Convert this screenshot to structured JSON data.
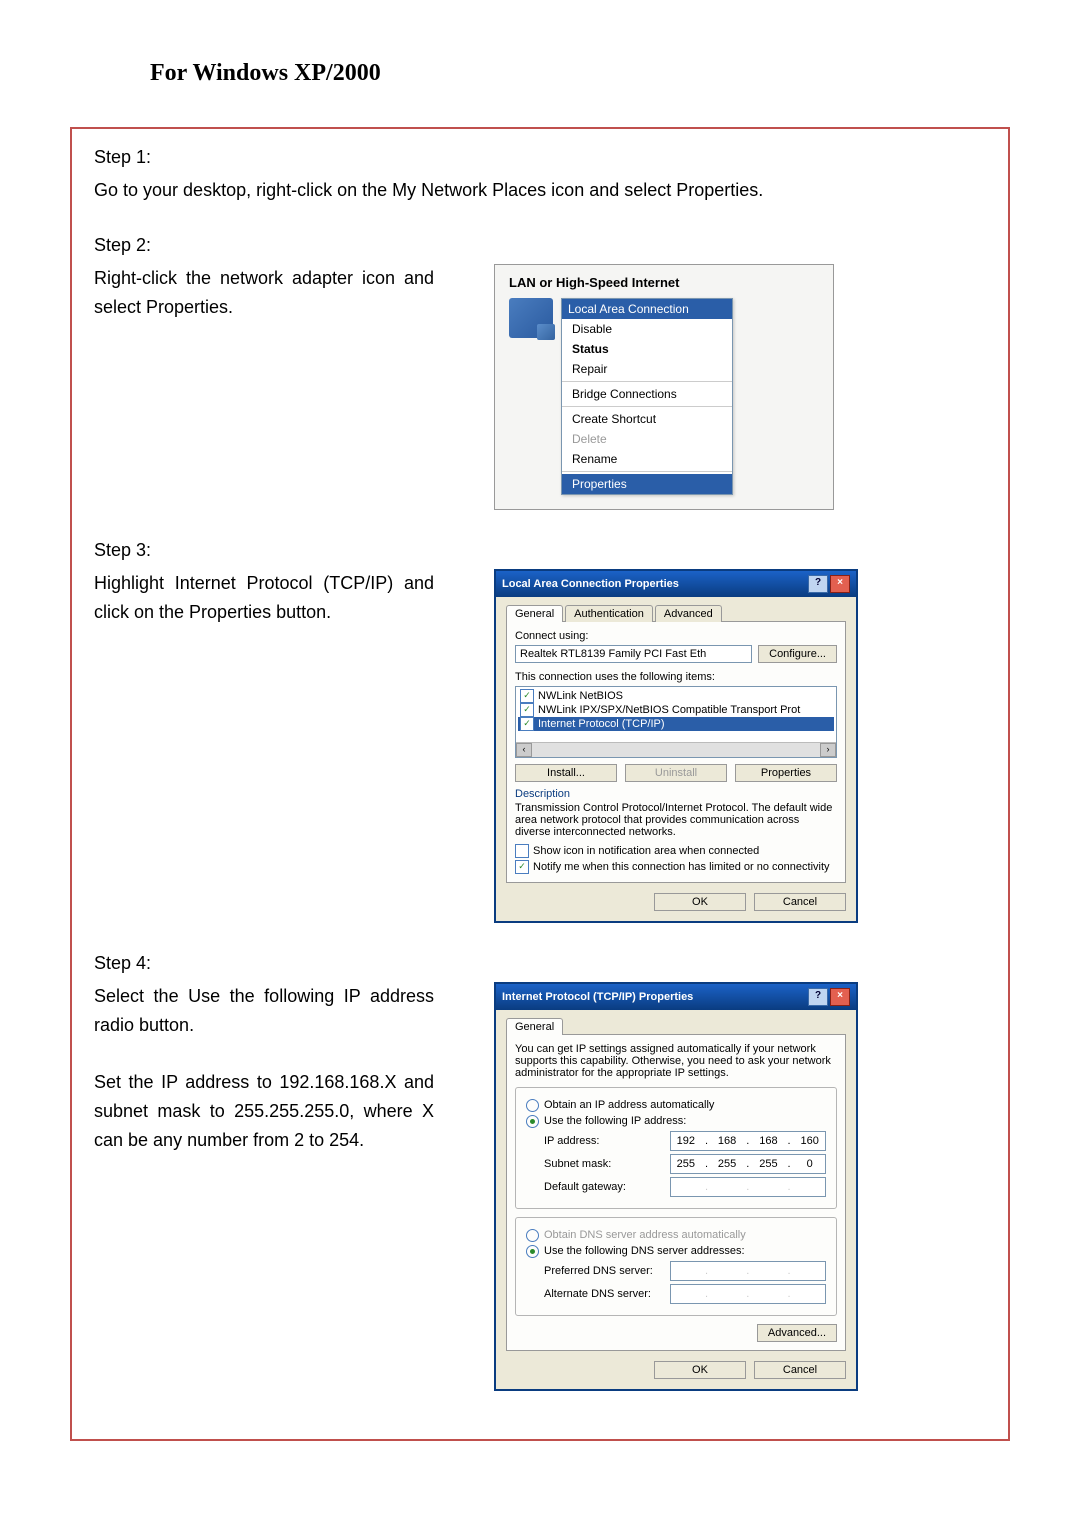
{
  "title": "For Windows XP/2000",
  "steps": {
    "s1": {
      "label": "Step 1:",
      "text": "Go to your desktop, right-click on the My Network Places icon and select Properties."
    },
    "s2": {
      "label": "Step 2:",
      "text": "Right-click the network adapter icon and select Properties."
    },
    "s3": {
      "label": "Step 3:",
      "text": "Highlight Internet Protocol (TCP/IP) and click on the Properties button."
    },
    "s4": {
      "label": "Step 4:",
      "text1": "Select the Use the following IP address radio button.",
      "text2": "Set the IP address to 192.168.168.X and subnet mask to 255.255.255.0, where X can be any number from 2 to 254."
    }
  },
  "ctxmenu": {
    "panelTitle": "LAN or High-Speed Internet",
    "header": "Local Area Connection",
    "items": {
      "disable": "Disable",
      "status": "Status",
      "repair": "Repair",
      "bridge": "Bridge Connections",
      "shortcut": "Create Shortcut",
      "delete": "Delete",
      "rename": "Rename",
      "properties": "Properties"
    }
  },
  "lanprops": {
    "title": "Local Area Connection Properties",
    "tabs": {
      "general": "General",
      "auth": "Authentication",
      "adv": "Advanced"
    },
    "connectUsing": "Connect using:",
    "adapter": "Realtek RTL8139 Family PCI Fast Eth",
    "configure": "Configure...",
    "listLabel": "This connection uses the following items:",
    "items": {
      "nwlink": "NWLink NetBIOS",
      "nwlinkipx": "NWLink IPX/SPX/NetBIOS Compatible Transport Prot",
      "tcpip": "Internet Protocol (TCP/IP)"
    },
    "install": "Install...",
    "uninstall": "Uninstall",
    "properties": "Properties",
    "descLabel": "Description",
    "descText": "Transmission Control Protocol/Internet Protocol. The default wide area network protocol that provides communication across diverse interconnected networks.",
    "cbNotify": "Show icon in notification area when connected",
    "cbLimited": "Notify me when this connection has limited or no connectivity",
    "ok": "OK",
    "cancel": "Cancel"
  },
  "tcpip": {
    "title": "Internet Protocol (TCP/IP) Properties",
    "tab": "General",
    "intro": "You can get IP settings assigned automatically if your network supports this capability. Otherwise, you need to ask your network administrator for the appropriate IP settings.",
    "autoIp": "Obtain an IP address automatically",
    "useIp": "Use the following IP address:",
    "ipLabel": "IP address:",
    "ipVal": {
      "a": "192",
      "b": "168",
      "c": "168",
      "d": "160"
    },
    "maskLabel": "Subnet mask:",
    "maskVal": {
      "a": "255",
      "b": "255",
      "c": "255",
      "d": "0"
    },
    "gwLabel": "Default gateway:",
    "autoDns": "Obtain DNS server address automatically",
    "useDns": "Use the following DNS server addresses:",
    "prefDns": "Preferred DNS server:",
    "altDns": "Alternate DNS server:",
    "advanced": "Advanced...",
    "ok": "OK",
    "cancel": "Cancel"
  }
}
